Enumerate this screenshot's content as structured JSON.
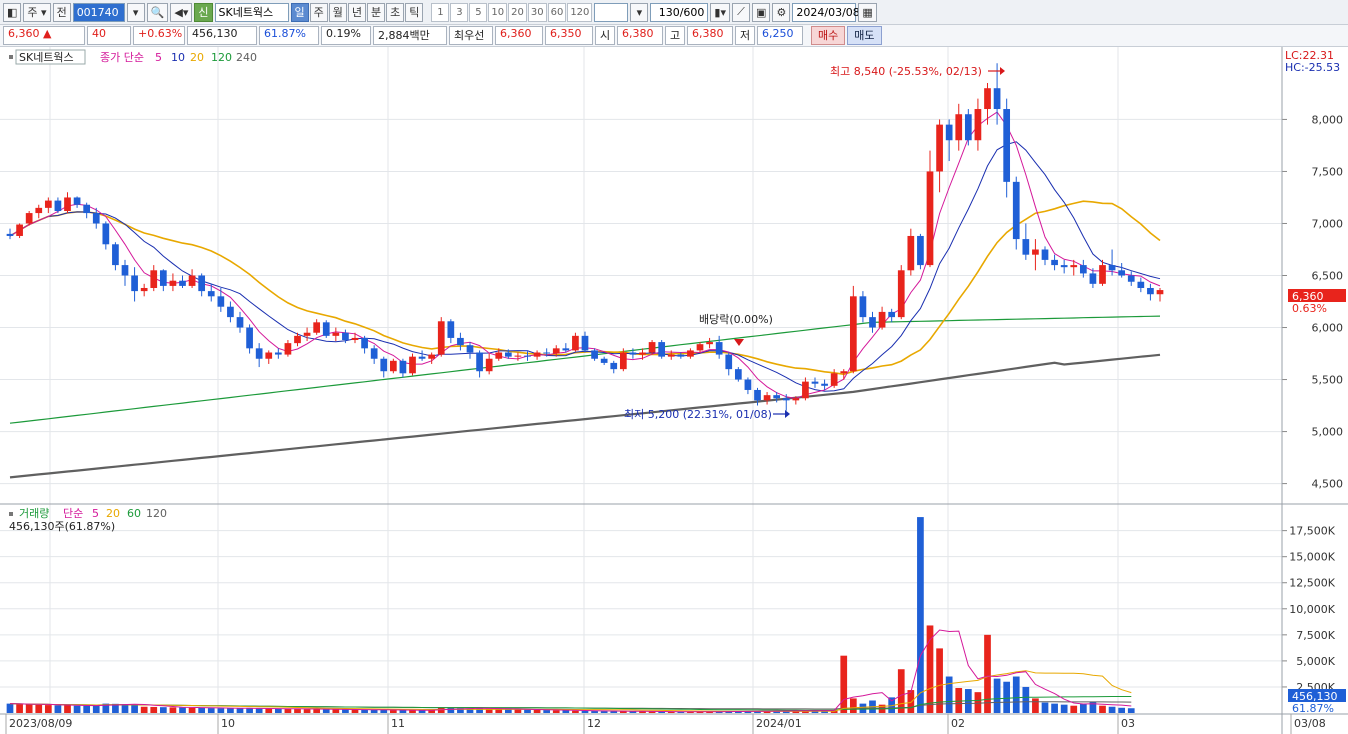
{
  "toolbar": {
    "market": "주",
    "prev_label": "전",
    "code": "001740",
    "name_badge": "신",
    "name": "SK네트웍스",
    "periods": [
      "일",
      "주",
      "월",
      "년",
      "분",
      "초",
      "틱"
    ],
    "active_period": "일",
    "minutes": [
      "1",
      "3",
      "5",
      "10",
      "20",
      "30",
      "60",
      "120"
    ],
    "count": "130/600",
    "date": "2024/03/08"
  },
  "quote": {
    "price": "6,360",
    "change_arrow": "▲",
    "change": "40",
    "change_pct": "+0.63%",
    "volume": "456,130",
    "vol_ratio": "61.87%",
    "turnover_pct": "0.19%",
    "amount": "2,884백만",
    "best_label": "최우선",
    "ask": "6,360",
    "bid": "6,350",
    "open_label": "시",
    "open": "6,380",
    "high_label": "고",
    "high": "6,380",
    "low_label": "저",
    "low": "6,250",
    "buy_label": "매수",
    "sell_label": "매도"
  },
  "price_panel": {
    "legend_name": "SK네트웍스",
    "legend_series": "종가 단순",
    "ma_periods": [
      "5",
      "10",
      "20",
      "120",
      "240"
    ],
    "max_label": "최고 8,540 (-25.53%, 02/13)",
    "min_label": "최저 5,200 (22.31%, 01/08)",
    "dividend_label": "배당락(0.00%)",
    "lc_label": "LC:22.31",
    "hc_label": "HC:-25.53",
    "current_price": "6,360",
    "current_pct": "0.63%",
    "y_ticks": [
      "8,000",
      "7,500",
      "7,000",
      "6,500",
      "6,000",
      "5,500",
      "5,000",
      "4,500"
    ]
  },
  "volume_panel": {
    "legend_name": "거래량",
    "legend_series": "단순",
    "ma_periods": [
      "5",
      "20",
      "60",
      "120"
    ],
    "readout": "456,130주(61.87%)",
    "current": "456,130",
    "current_pct": "61.87%",
    "y_ticks": [
      "17,500K",
      "15,000K",
      "12,500K",
      "10,000K",
      "7,500K",
      "5,000K",
      "2,500K"
    ]
  },
  "x_labels": [
    "2023/08/09",
    "10",
    "11",
    "12",
    "2024/01",
    "02",
    "03",
    "03/08"
  ],
  "colors": {
    "up": "#e8241c",
    "down": "#1f5fd6",
    "ma5": "#d4189a",
    "ma10": "#1a2fb0",
    "ma20": "#e8a800",
    "ma120": "#1c9a3a",
    "ma240": "#606060"
  },
  "chart_data": {
    "type": "candlestick",
    "ylim": [
      4400,
      8600
    ],
    "candles": [
      [
        6900,
        6950,
        6850,
        6880
      ],
      [
        6880,
        7000,
        6860,
        6990
      ],
      [
        7000,
        7120,
        6980,
        7100
      ],
      [
        7100,
        7180,
        7050,
        7150
      ],
      [
        7150,
        7250,
        7100,
        7220
      ],
      [
        7220,
        7250,
        7100,
        7120
      ],
      [
        7120,
        7300,
        7100,
        7250
      ],
      [
        7250,
        7260,
        7150,
        7180
      ],
      [
        7180,
        7200,
        7050,
        7100
      ],
      [
        7100,
        7150,
        6950,
        7000
      ],
      [
        7000,
        7020,
        6750,
        6800
      ],
      [
        6800,
        6820,
        6550,
        6600
      ],
      [
        6600,
        6650,
        6400,
        6500
      ],
      [
        6500,
        6580,
        6250,
        6350
      ],
      [
        6350,
        6420,
        6300,
        6380
      ],
      [
        6380,
        6600,
        6350,
        6550
      ],
      [
        6550,
        6560,
        6350,
        6400
      ],
      [
        6400,
        6520,
        6350,
        6450
      ],
      [
        6450,
        6500,
        6380,
        6400
      ],
      [
        6400,
        6560,
        6380,
        6500
      ],
      [
        6500,
        6520,
        6300,
        6350
      ],
      [
        6350,
        6420,
        6250,
        6300
      ],
      [
        6300,
        6380,
        6150,
        6200
      ],
      [
        6200,
        6250,
        6050,
        6100
      ],
      [
        6100,
        6150,
        5950,
        6000
      ],
      [
        6000,
        6030,
        5750,
        5800
      ],
      [
        5800,
        5850,
        5620,
        5700
      ],
      [
        5700,
        5780,
        5650,
        5760
      ],
      [
        5760,
        5800,
        5700,
        5740
      ],
      [
        5740,
        5880,
        5720,
        5850
      ],
      [
        5850,
        5950,
        5820,
        5920
      ],
      [
        5920,
        6000,
        5870,
        5950
      ],
      [
        5950,
        6080,
        5930,
        6050
      ],
      [
        6050,
        6070,
        5900,
        5920
      ],
      [
        5920,
        6000,
        5870,
        5950
      ],
      [
        5950,
        5980,
        5850,
        5880
      ],
      [
        5880,
        5950,
        5850,
        5900
      ],
      [
        5900,
        5920,
        5750,
        5800
      ],
      [
        5800,
        5830,
        5650,
        5700
      ],
      [
        5700,
        5720,
        5520,
        5580
      ],
      [
        5580,
        5700,
        5560,
        5680
      ],
      [
        5680,
        5700,
        5520,
        5560
      ],
      [
        5560,
        5750,
        5540,
        5720
      ],
      [
        5720,
        5780,
        5680,
        5700
      ],
      [
        5700,
        5760,
        5650,
        5740
      ],
      [
        5740,
        6100,
        5720,
        6060
      ],
      [
        6060,
        6080,
        5850,
        5900
      ],
      [
        5900,
        5950,
        5780,
        5830
      ],
      [
        5830,
        5860,
        5700,
        5760
      ],
      [
        5760,
        5780,
        5520,
        5580
      ],
      [
        5580,
        5750,
        5550,
        5700
      ],
      [
        5700,
        5800,
        5680,
        5760
      ],
      [
        5760,
        5790,
        5700,
        5720
      ],
      [
        5720,
        5760,
        5680,
        5730
      ],
      [
        5730,
        5770,
        5680,
        5720
      ],
      [
        5720,
        5780,
        5690,
        5760
      ],
      [
        5760,
        5800,
        5720,
        5750
      ],
      [
        5750,
        5830,
        5720,
        5800
      ],
      [
        5800,
        5850,
        5760,
        5780
      ],
      [
        5780,
        5950,
        5770,
        5920
      ],
      [
        5920,
        5960,
        5760,
        5780
      ],
      [
        5780,
        5800,
        5680,
        5700
      ],
      [
        5700,
        5720,
        5640,
        5660
      ],
      [
        5660,
        5680,
        5560,
        5600
      ],
      [
        5600,
        5800,
        5580,
        5760
      ],
      [
        5760,
        5800,
        5700,
        5740
      ],
      [
        5740,
        5800,
        5690,
        5760
      ],
      [
        5760,
        5880,
        5740,
        5860
      ],
      [
        5860,
        5880,
        5700,
        5720
      ],
      [
        5720,
        5780,
        5690,
        5740
      ],
      [
        5740,
        5760,
        5700,
        5720
      ],
      [
        5720,
        5800,
        5700,
        5780
      ],
      [
        5780,
        5860,
        5760,
        5840
      ],
      [
        5840,
        5900,
        5800,
        5860
      ],
      [
        5860,
        5920,
        5700,
        5740
      ],
      [
        5740,
        5760,
        5540,
        5600
      ],
      [
        5600,
        5620,
        5480,
        5500
      ],
      [
        5500,
        5520,
        5360,
        5400
      ],
      [
        5400,
        5420,
        5250,
        5300
      ],
      [
        5300,
        5380,
        5260,
        5350
      ],
      [
        5350,
        5380,
        5280,
        5320
      ],
      [
        5320,
        5360,
        5200,
        5300
      ],
      [
        5300,
        5340,
        5260,
        5320
      ],
      [
        5320,
        5520,
        5300,
        5480
      ],
      [
        5480,
        5520,
        5420,
        5460
      ],
      [
        5460,
        5500,
        5400,
        5440
      ],
      [
        5440,
        5600,
        5420,
        5560
      ],
      [
        5560,
        5600,
        5500,
        5580
      ],
      [
        5580,
        6400,
        5560,
        6300
      ],
      [
        6300,
        6350,
        6050,
        6100
      ],
      [
        6100,
        6150,
        5950,
        6000
      ],
      [
        6000,
        6200,
        5980,
        6150
      ],
      [
        6150,
        6180,
        6050,
        6100
      ],
      [
        6100,
        6600,
        6080,
        6550
      ],
      [
        6550,
        6950,
        6500,
        6880
      ],
      [
        6880,
        6900,
        6560,
        6600
      ],
      [
        6600,
        7700,
        6580,
        7500
      ],
      [
        7500,
        8000,
        7300,
        7950
      ],
      [
        7950,
        8000,
        7600,
        7800
      ],
      [
        7800,
        8150,
        7700,
        8050
      ],
      [
        8050,
        8100,
        7750,
        7800
      ],
      [
        7800,
        8200,
        7700,
        8100
      ],
      [
        8100,
        8350,
        7950,
        8300
      ],
      [
        8300,
        8540,
        7950,
        8100
      ],
      [
        8100,
        8200,
        7250,
        7400
      ],
      [
        7400,
        7450,
        6750,
        6850
      ],
      [
        6850,
        7000,
        6650,
        6700
      ],
      [
        6700,
        6850,
        6550,
        6750
      ],
      [
        6750,
        6780,
        6600,
        6650
      ],
      [
        6650,
        6700,
        6550,
        6600
      ],
      [
        6600,
        6650,
        6520,
        6580
      ],
      [
        6580,
        6650,
        6500,
        6600
      ],
      [
        6600,
        6650,
        6480,
        6520
      ],
      [
        6520,
        6570,
        6380,
        6420
      ],
      [
        6420,
        6650,
        6400,
        6600
      ],
      [
        6600,
        6750,
        6500,
        6550
      ],
      [
        6550,
        6620,
        6480,
        6500
      ],
      [
        6500,
        6540,
        6400,
        6440
      ],
      [
        6440,
        6480,
        6340,
        6380
      ],
      [
        6380,
        6420,
        6260,
        6320
      ],
      [
        6320,
        6380,
        6250,
        6360
      ]
    ],
    "volume_ylim": [
      0,
      19000
    ],
    "volumes": [
      900,
      850,
      820,
      780,
      760,
      740,
      720,
      700,
      690,
      680,
      900,
      880,
      860,
      840,
      600,
      580,
      560,
      540,
      520,
      500,
      480,
      470,
      460,
      450,
      440,
      430,
      420,
      410,
      400,
      390,
      380,
      370,
      360,
      350,
      340,
      330,
      320,
      310,
      300,
      290,
      280,
      270,
      260,
      250,
      240,
      500,
      480,
      460,
      440,
      420,
      400,
      380,
      360,
      340,
      320,
      300,
      280,
      260,
      240,
      220,
      200,
      190,
      180,
      170,
      160,
      150,
      140,
      130,
      120,
      110,
      100,
      110,
      120,
      130,
      140,
      150,
      160,
      170,
      180,
      190,
      200,
      210,
      220,
      230,
      240,
      250,
      260,
      5500,
      1400,
      900,
      1200,
      800,
      1500,
      4200,
      2200,
      18800,
      8400,
      6200,
      3500,
      2400,
      2300,
      2000,
      7500,
      3300,
      3000,
      3500,
      2500,
      1400,
      1000,
      900,
      800,
      700,
      900,
      1100,
      700,
      600,
      500,
      456
    ]
  }
}
